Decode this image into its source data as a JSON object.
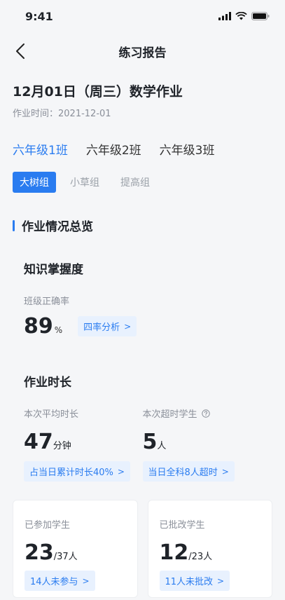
{
  "status": {
    "time": "9:41"
  },
  "nav": {
    "title": "练习报告"
  },
  "homework": {
    "title": "12月01日（周三）数学作业",
    "time_label": "作业时间：2021-12-01"
  },
  "class_tabs": [
    "六年级1班",
    "六年级2班",
    "六年级3班"
  ],
  "group_tabs": [
    "大树组",
    "小草组",
    "提高组"
  ],
  "overview": {
    "section_title": "作业情况总览",
    "knowledge": {
      "title": "知识掌握度",
      "accuracy_label": "班级正确率",
      "accuracy_value": "89",
      "accuracy_unit": "%",
      "analysis_chip": "四率分析"
    },
    "duration": {
      "title": "作业时长",
      "avg_label": "本次平均时长",
      "avg_value": "47",
      "avg_unit": "分钟",
      "avg_chip": "占当日累计时长40%",
      "over_label": "本次超时学生",
      "over_value": "5",
      "over_unit": "人",
      "over_chip": "当日全科8人超时"
    },
    "joined": {
      "label": "已参加学生",
      "value": "23",
      "total": "/37人",
      "chip": "14人未参与"
    },
    "graded": {
      "label": "已批改学生",
      "value": "12",
      "total": "/23人",
      "chip": "11人未批改"
    }
  },
  "icons": {
    "back": "chevron-left-icon",
    "help": "help-circle-icon",
    "chip_arrow": "chevron-right-icon"
  },
  "colors": {
    "accent": "#2a7cf0",
    "chip_bg": "#e8f1fe"
  }
}
